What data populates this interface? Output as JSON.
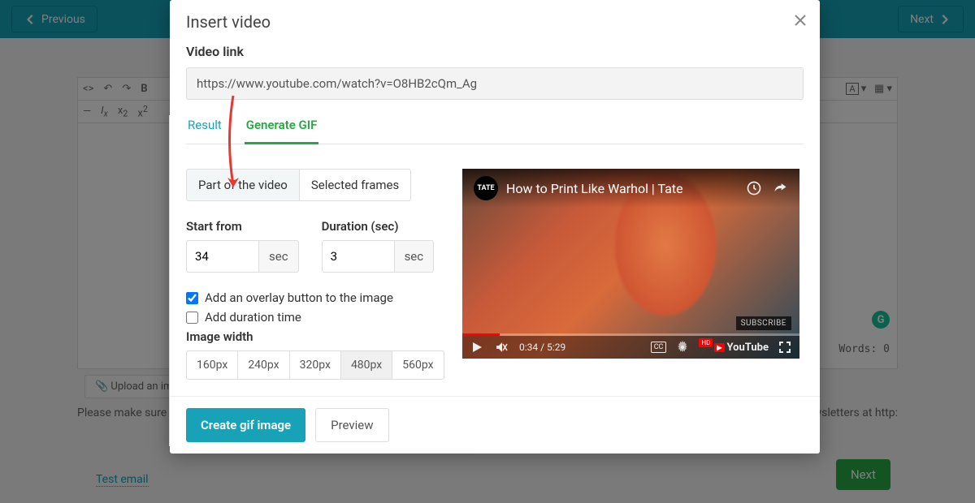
{
  "bg": {
    "prev": "Previous",
    "next": "Next",
    "words_label": "Words: 0",
    "upload": "Upload an ima",
    "note": "Please make sure to",
    "note2": "subscribed to our newsletters at http:",
    "test_email": "Test email",
    "next2": "Next",
    "gram": "G"
  },
  "modal": {
    "title": "Insert video",
    "video_link_label": "Video link",
    "video_link_value": "https://www.youtube.com/watch?v=O8HB2cQm_Ag",
    "tabs": {
      "result": "Result",
      "generate": "Generate GIF"
    },
    "seg": {
      "part": "Part of the video",
      "frames": "Selected frames"
    },
    "start_label": "Start from",
    "start_value": "34",
    "duration_label": "Duration (sec)",
    "duration_value": "3",
    "unit": "sec",
    "check_overlay": "Add an overlay button to the image",
    "check_duration": "Add duration time",
    "image_width_label": "Image width",
    "widths": [
      "160px",
      "240px",
      "320px",
      "480px",
      "560px"
    ],
    "footer": {
      "create": "Create gif image",
      "preview": "Preview"
    }
  },
  "video": {
    "logo": "TATE",
    "title": "How to Print Like Warhol | Tate",
    "subscribe": "SUBSCRIBE",
    "time": "0:34 / 5:29",
    "cc": "CC",
    "hd": "HD",
    "yt": "YouTube"
  }
}
